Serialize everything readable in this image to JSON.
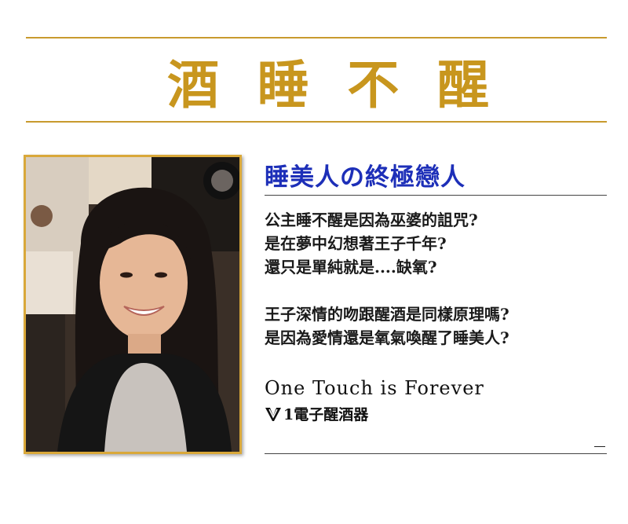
{
  "headline": {
    "chars": [
      "酒",
      "睡",
      "不",
      "醒"
    ]
  },
  "subtitle": "睡美人の終極戀人",
  "paragraph1": [
    "公主睡不醒是因為巫婆的詛咒?",
    "是在夢中幻想著王子千年?",
    "還只是單純就是....缺氧?"
  ],
  "paragraph2": [
    "王子深情的吻跟醒酒是同樣原理嗎?",
    "是因為愛情還是氧氣喚醒了睡美人?"
  ],
  "slogan": "One Touch is Forever",
  "brand": "1電子醒酒器",
  "colors": {
    "gold": "#c8961e",
    "subtitle_blue": "#1d2fb8"
  }
}
